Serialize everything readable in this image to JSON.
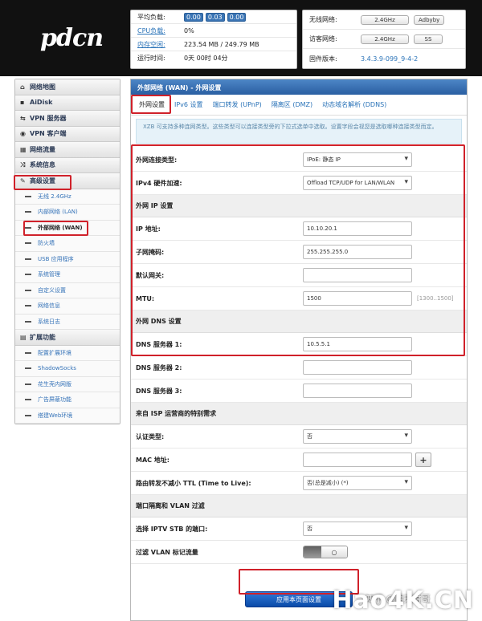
{
  "logo": "pdcn",
  "status_left": {
    "rows": [
      {
        "label": "平均负载:",
        "badges": [
          "0.00",
          "0.03",
          "0.00"
        ]
      },
      {
        "label": "CPU负载:",
        "value": "0%"
      },
      {
        "label": "内存空闲:",
        "value": "223.54 MB / 249.79 MB"
      },
      {
        "label": "运行时间:",
        "value": "0天 00时 04分"
      }
    ]
  },
  "status_right": {
    "rows": [
      {
        "label": "无线网络:",
        "btn1": "2.4GHz",
        "btn2": "Adbyby"
      },
      {
        "label": "访客网络:",
        "btn1": "2.4GHz",
        "btn2": "SS"
      },
      {
        "label": "固件版本:",
        "value": "3.4.3.9-099_9-4-2"
      }
    ]
  },
  "sidebar": {
    "group1": [
      {
        "icon": "home-icon",
        "glyph": "⌂",
        "label": "网络地图"
      },
      {
        "icon": "disk-icon",
        "glyph": "▪",
        "label": "AiDisk"
      },
      {
        "icon": "vpn-server-icon",
        "glyph": "⇆",
        "label": "VPN 服务器"
      },
      {
        "icon": "vpn-client-icon",
        "glyph": "◉",
        "label": "VPN 客户端"
      },
      {
        "icon": "traffic-icon",
        "glyph": "▦",
        "label": "网络流量"
      },
      {
        "icon": "shuffle-icon",
        "glyph": "⤨",
        "label": "系统信息"
      }
    ],
    "advanced": {
      "icon": "wrench-icon",
      "glyph": "✎",
      "label": "高级设置"
    },
    "advanced_items": [
      "无线 2.4GHz",
      "内部网络 (LAN)",
      "外部网络 (WAN)",
      "防火墙",
      "USB 应用程序",
      "系统管理",
      "自定义设置",
      "网络信息",
      "系统日志"
    ],
    "active_item": "外部网络 (WAN)",
    "extension": {
      "icon": "grid-icon",
      "glyph": "▤",
      "label": "扩展功能"
    },
    "extension_items": [
      "配置扩展环境",
      "ShadowSocks",
      "花生壳内网版",
      "广告屏蔽功能",
      "搭建Web环境"
    ]
  },
  "main": {
    "title": "外部网络 (WAN) - 外网设置",
    "tabs": [
      "外网设置",
      "IPv6 设置",
      "端口转发 (UPnP)",
      "隔离区 (DMZ)",
      "动态域名解析 (DDNS)"
    ],
    "info": "XZB 可支持多种连网类型。这些类型可以连接类型旁的下拉式选单中选取。设置字段会视您是选取哪种连接类型而定。",
    "conn_type_label": "外网连接类型:",
    "conn_type_value": "IPoE: 静态 IP",
    "hw_accel_label": "IPv4 硬件加速:",
    "hw_accel_value": "Offload TCP/UDP for LAN/WLAN",
    "ip_section": "外网 IP 设置",
    "ip_label": "IP 地址:",
    "ip_value": "10.10.20.1",
    "mask_label": "子网掩码:",
    "mask_value": "255.255.255.0",
    "gateway_label": "默认网关:",
    "gateway_value": "",
    "mtu_label": "MTU:",
    "mtu_value": "1500",
    "mtu_hint": "[1300..1500]",
    "dns_section": "外网 DNS 设置",
    "dns1_label": "DNS 服务器 1:",
    "dns1_value": "10.5.5.1",
    "dns2_label": "DNS 服务器 2:",
    "dns2_value": "",
    "dns3_label": "DNS 服务器 3:",
    "dns3_value": "",
    "isp_section": "来自 ISP 运营商的特别需求",
    "auth_label": "认证类型:",
    "auth_value": "否",
    "mac_label": "MAC 地址:",
    "mac_value": "",
    "ttl_label": "路由转发不减小 TTL (Time to Live):",
    "ttl_value": "否(总是减小) (*)",
    "vlan_section": "端口隔离和 VLAN 过滤",
    "iptv_label": "选择 IPTV STB 的端口:",
    "iptv_value": "否",
    "vlan_filter_label": "过滤 VLAN 标记流量",
    "apply_label": "应用本页面设置"
  },
  "watermark": "Hao4K.CN",
  "watermark_sub": "知乎 @情天君哥",
  "colors": {
    "header_blue": "#2a5fa2",
    "highlight_red": "#d0212a",
    "link_blue": "#2a73b8"
  }
}
